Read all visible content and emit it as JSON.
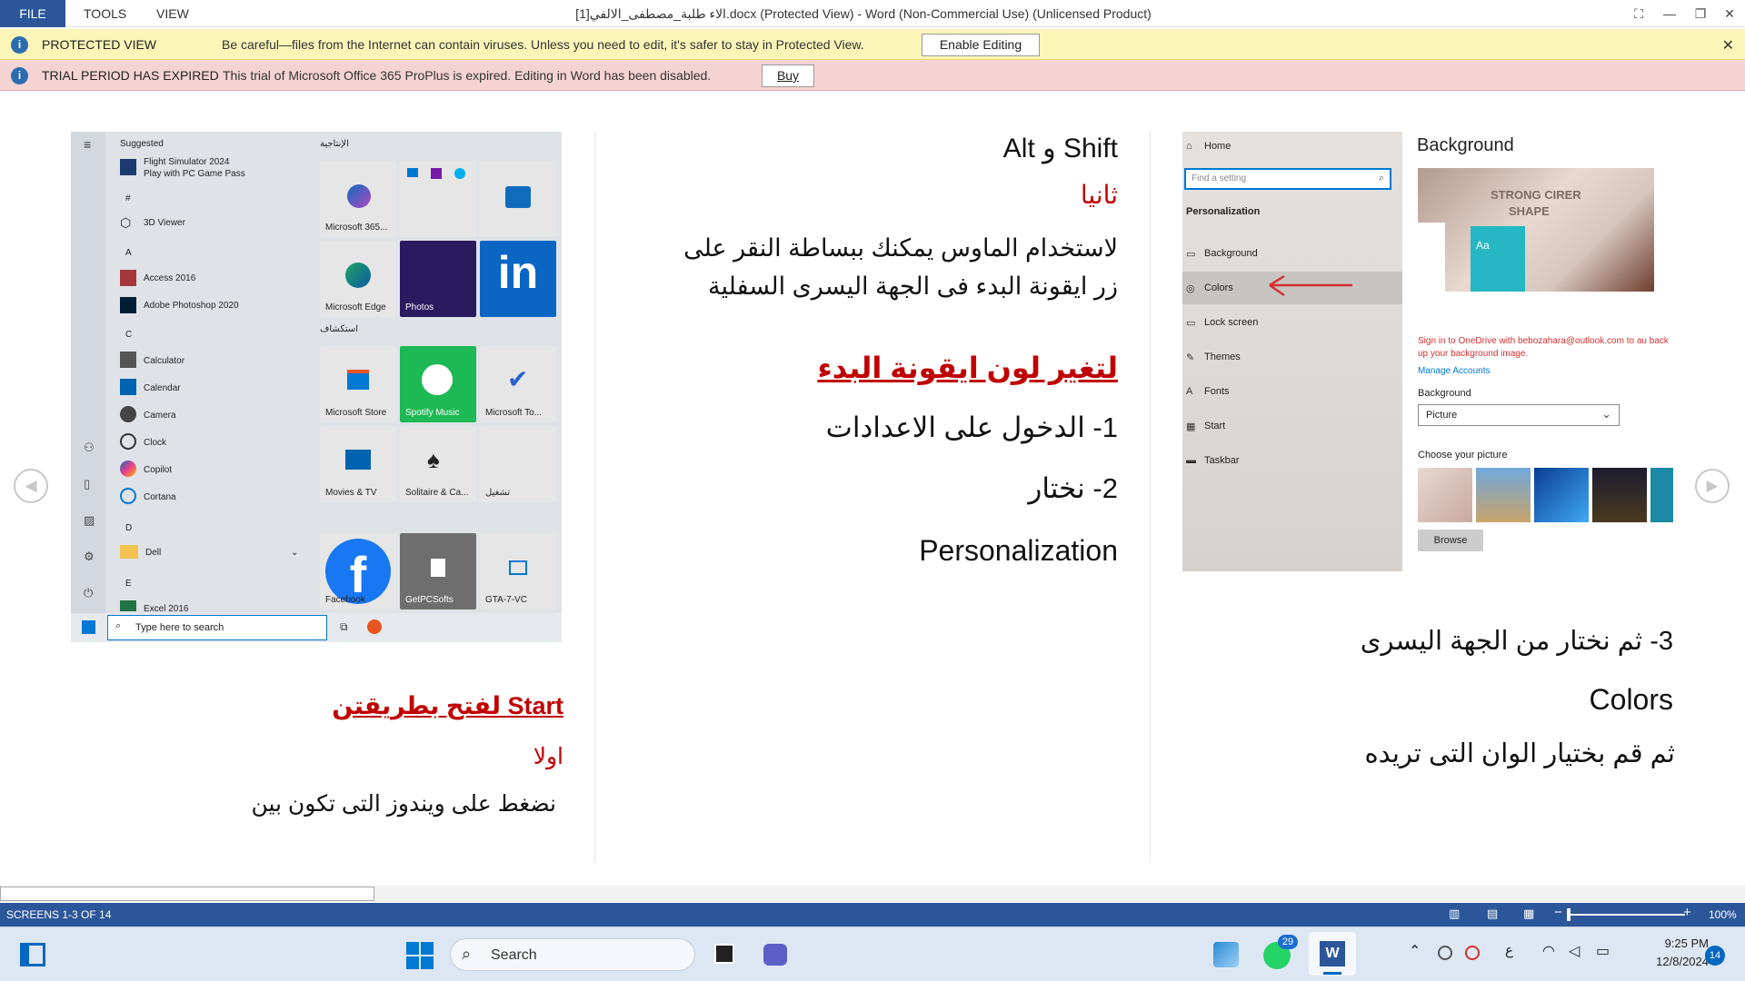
{
  "titlebar": {
    "file_tab": "FILE",
    "menu": [
      "TOOLS",
      "VIEW"
    ],
    "doc_title": "الاء طلبة_مصطفى_الالفي[1].docx (Protected View) - Word (Non-Commercial Use) (Unlicensed Product)"
  },
  "protected_bar": {
    "title": "PROTECTED VIEW",
    "message": "Be careful—files from the Internet can contain viruses. Unless you need to edit, it's safer to stay in Protected View.",
    "button": "Enable Editing"
  },
  "trial_bar": {
    "title": "TRIAL PERIOD HAS EXPIRED",
    "message": "This trial of Microsoft Office 365 ProPlus is expired. Editing in Word has been disabled.",
    "button": "Buy"
  },
  "start_menu": {
    "suggested": "Suggested",
    "suggested_item": "Flight Simulator 2024",
    "suggested_sub": "Play with PC Game Pass",
    "hash": "#",
    "viewer": "3D Viewer",
    "letter_a": "A",
    "access": "Access 2016",
    "photoshop": "Adobe Photoshop 2020",
    "letter_c": "C",
    "calculator": "Calculator",
    "calendar": "Calendar",
    "camera": "Camera",
    "clock": "Clock",
    "copilot": "Copilot",
    "cortana": "Cortana",
    "letter_d": "D",
    "dell": "Dell",
    "letter_e": "E",
    "excel": "Excel 2016",
    "group1": "الإنتاجية",
    "group2": "استكشاف",
    "tile_m365": "Microsoft 365...",
    "tile_edge": "Microsoft Edge",
    "tile_photos": "Photos",
    "tile_store": "Microsoft Store",
    "tile_spotify": "Spotify Music",
    "tile_todo": "Microsoft To...",
    "tile_movies": "Movies & TV",
    "tile_solitaire": "Solitaire & Ca...",
    "tile_play": "تشغيل",
    "tile_facebook": "Facebook",
    "tile_getpc": "GetPCSofts",
    "tile_gta": "GTA-7-VC",
    "search_placeholder": "Type here to search",
    "linkedin": "in"
  },
  "col_left": {
    "heading": "Start لفتح بطريقتن",
    "first": "اولا",
    "text": "نضغط على ويندوز التى تكون بين"
  },
  "col_middle": {
    "shortcut": "Shift و Alt",
    "second": "ثانيا",
    "para1": "لاستخدام الماوس يمكنك ببساطة النقر على زر ايقونة البدء فى الجهة اليسرى السفلية",
    "heading": "لتغير لون ايقونة البدء",
    "step1": "1- الدخول على الاعدادات",
    "step2": "2- نختار",
    "step2b": "Personalization"
  },
  "settings_shot": {
    "home": "Home",
    "find": "Find a setting",
    "section": "Personalization",
    "items": [
      "Background",
      "Colors",
      "Lock screen",
      "Themes",
      "Fonts",
      "Start",
      "Taskbar"
    ],
    "title": "Background",
    "warning": "Sign in to OneDrive with bebozahara@outlook.com to au back up your background image.",
    "manage": "Manage Accounts",
    "bg_label": "Background",
    "bg_value": "Picture",
    "choose": "Choose your picture",
    "browse": "Browse",
    "preview_text": "STRONG CIRER",
    "preview_text2": "SHAPE",
    "preview_aa": "Aa"
  },
  "col_right": {
    "step3": "3- ثم نختار من الجهة اليسرى",
    "colors": "Colors",
    "last": "ثم قم بختيار الوان التى تريده"
  },
  "statusbar": {
    "screens": "SCREENS 1-3 OF 14",
    "zoom": "100%"
  },
  "taskbar": {
    "search": "Search",
    "whatsapp_badge": "29",
    "lang": "ع",
    "time": "9:25 PM",
    "date": "12/8/2024",
    "notif": "14"
  },
  "colors": {
    "word_blue": "#2b579a",
    "protected_yellow": "#fbf5b8",
    "trial_pink": "#f5d3d3",
    "heading_red": "#c00000",
    "spotify_green": "#1db954",
    "linkedin_blue": "#0a66c2"
  }
}
